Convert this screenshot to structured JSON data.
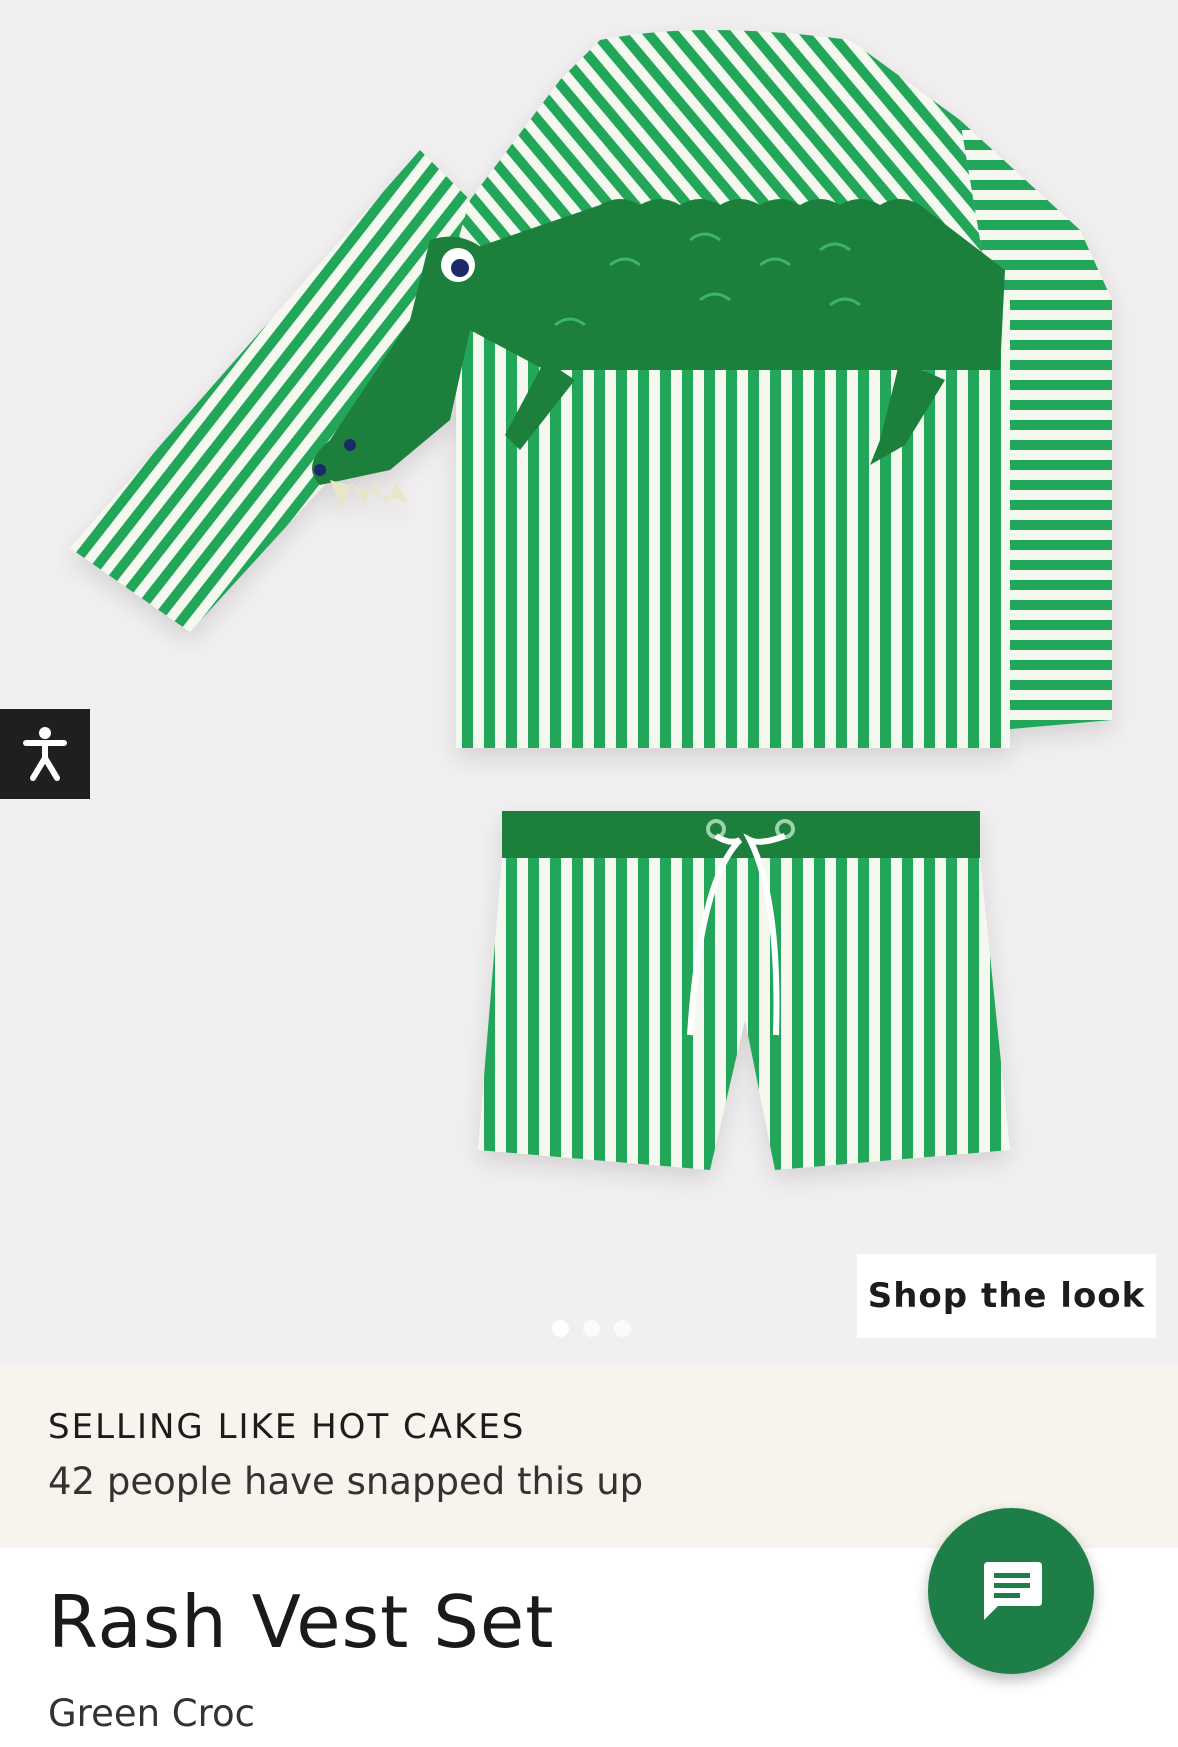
{
  "gallery": {
    "shop_the_look_label": "Shop the look",
    "slide_count": 3,
    "active_slide": 1
  },
  "accessibility": {
    "icon": "accessibility-person-icon"
  },
  "banner": {
    "title": "SELLING LIKE HOT CAKES",
    "subtitle": "42 people have snapped this up"
  },
  "product": {
    "name": "Rash Vest Set",
    "colour": "Green Croc"
  },
  "chat": {
    "icon": "chat-message-icon"
  },
  "colors": {
    "stripe_green": "#22a65a",
    "croc_dark": "#1f7f3a",
    "chat_button": "#1d7f47",
    "banner_bg": "#f7f4ee",
    "gallery_bg": "#f1eff0"
  }
}
